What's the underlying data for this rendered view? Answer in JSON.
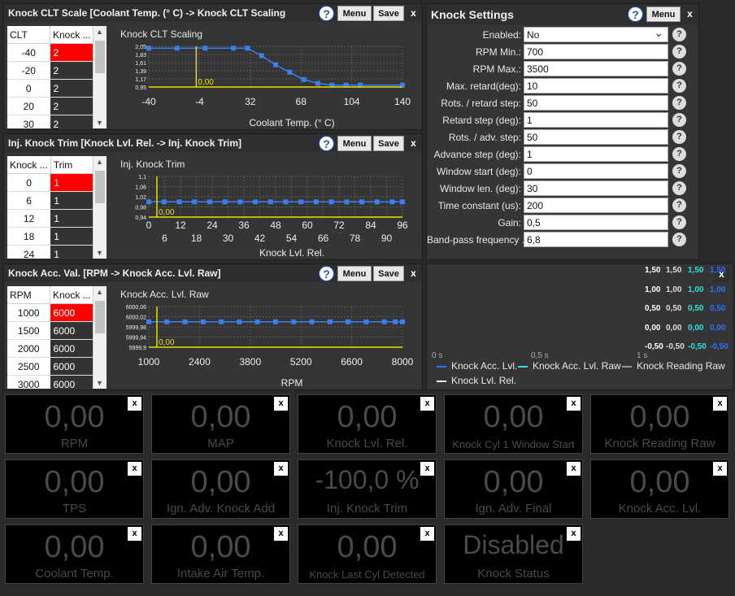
{
  "clt_panel": {
    "title": "Knock CLT Scale [Coolant Temp. (° C) -> Knock CLT Scaling",
    "menu": "Menu",
    "save": "Save",
    "close": "x",
    "help": "?",
    "col_key": "CLT",
    "col_val": "Knock ...",
    "rows": [
      [
        "-40",
        "2"
      ],
      [
        "-20",
        "2"
      ],
      [
        "0",
        "2"
      ],
      [
        "20",
        "2"
      ],
      [
        "30",
        "2"
      ]
    ],
    "chart_title": "Knock CLT Scaling"
  },
  "trim_panel": {
    "title": "Inj. Knock Trim [Knock Lvl. Rel. -> Inj. Knock Trim]",
    "menu": "Menu",
    "save": "Save",
    "close": "x",
    "help": "?",
    "col_key": "Knock ...",
    "col_val": "Trim",
    "rows": [
      [
        "0",
        "1"
      ],
      [
        "6",
        "1"
      ],
      [
        "12",
        "1"
      ],
      [
        "18",
        "1"
      ],
      [
        "24",
        "1"
      ]
    ],
    "chart_title": "Inj. Knock Trim"
  },
  "acc_panel": {
    "title": "Knock Acc. Val. [RPM -> Knock Acc. Lvl. Raw]",
    "menu": "Menu",
    "save": "Save",
    "close": "x",
    "help": "?",
    "col_key": "RPM",
    "col_val": "Knock ...",
    "rows": [
      [
        "1000",
        "6000"
      ],
      [
        "1500",
        "6000"
      ],
      [
        "2000",
        "6000"
      ],
      [
        "2500",
        "6000"
      ],
      [
        "3000",
        "6000"
      ]
    ],
    "chart_title": "Knock Acc. Lvl. Raw"
  },
  "settings": {
    "title": "Knock Settings",
    "menu": "Menu",
    "close": "x",
    "help": "?",
    "rows": [
      {
        "label": "Enabled:",
        "value": "No",
        "dropdown": true
      },
      {
        "label": "RPM Min.:",
        "value": "700"
      },
      {
        "label": "RPM Max.:",
        "value": "3500"
      },
      {
        "label": "Max. retard(deg):",
        "value": "10"
      },
      {
        "label": "Rots. / retard step:",
        "value": "50"
      },
      {
        "label": "Retard step (deg):",
        "value": "1"
      },
      {
        "label": "Rots. / adv. step:",
        "value": "50"
      },
      {
        "label": "Advance step (deg):",
        "value": "1"
      },
      {
        "label": "Window start (deg):",
        "value": "0"
      },
      {
        "label": "Window len. (deg):",
        "value": "30"
      },
      {
        "label": "Time constant (us):",
        "value": "200"
      },
      {
        "label": "Gain:",
        "value": "0,5"
      },
      {
        "label": "Band-pass frequency ...",
        "value": "6,8"
      }
    ]
  },
  "scope": {
    "close": "x",
    "time_labels": [
      "0 s",
      "0,5 s",
      "1 s"
    ],
    "legend": [
      "Knock Acc. Lvl.",
      "Knock Acc. Lvl. Raw",
      "Knock Reading Raw",
      "Knock Lvl. Rel."
    ],
    "axis_cols": [
      {
        "color": "#ffffff",
        "labels": [
          "1,50",
          "1,00",
          "0,50",
          "0,00",
          "-0,50"
        ]
      },
      {
        "color": "#dddddd",
        "labels": [
          "1,50",
          "1,00",
          "0,50",
          "0,00",
          "-0,50"
        ]
      },
      {
        "color": "#30e0e0",
        "labels": [
          "1,50",
          "1,00",
          "0,50",
          "0,00",
          "-0,50"
        ]
      },
      {
        "color": "#3070ff",
        "labels": [
          "1,50",
          "1,00",
          "0,50",
          "0,00",
          "-0,50"
        ]
      }
    ]
  },
  "gauges": [
    {
      "value": "0,00",
      "label": "RPM"
    },
    {
      "value": "0,00",
      "label": "MAP"
    },
    {
      "value": "0,00",
      "label": "Knock Lvl. Rel."
    },
    {
      "value": "0,00",
      "label": "Knock Cyl 1 Window Start"
    },
    {
      "value": "0,00",
      "label": "Knock Reading Raw"
    },
    {
      "value": "0,00",
      "label": "TPS"
    },
    {
      "value": "0,00",
      "label": "Ign. Adv. Knock Add"
    },
    {
      "value": "-100,0 %",
      "label": "Inj. Knock Trim"
    },
    {
      "value": "0,00",
      "label": "Ign. Adv. Final"
    },
    {
      "value": "0,00",
      "label": "Knock Acc. Lvl."
    },
    {
      "value": "0,00",
      "label": "Coolant Temp."
    },
    {
      "value": "0,00",
      "label": "Intake Air Temp."
    },
    {
      "value": "0,00",
      "label": "Knock Last Cyl Detected"
    },
    {
      "value": "Disabled",
      "label": "Knock Status"
    }
  ],
  "gauge_close": "x",
  "chart_data": [
    {
      "type": "line",
      "xlabel": "Coolant Temp. (° C)",
      "x_ticks": [
        "-40",
        "-4",
        "32",
        "68",
        "104",
        "140"
      ],
      "y_ticks": [
        "2,05",
        "1,83",
        "1,61",
        "1,39",
        "1,17",
        "0,95"
      ],
      "cursor_label": "0,00",
      "xlim": [
        -40,
        140
      ],
      "ylim": [
        0.95,
        2.05
      ],
      "x": [
        -40,
        -20,
        0,
        20,
        30,
        40,
        50,
        60,
        70,
        80,
        90,
        100,
        110,
        140
      ],
      "values": [
        2,
        2,
        2,
        2,
        2,
        1.8,
        1.55,
        1.35,
        1.15,
        1.05,
        1,
        1,
        1,
        1
      ]
    },
    {
      "type": "line",
      "xlabel": "Knock Lvl. Rel.",
      "x_ticks": [
        "0",
        "6",
        "12",
        "18",
        "24",
        "30",
        "36",
        "42",
        "48",
        "54",
        "60",
        "66",
        "72",
        "78",
        "84",
        "90",
        "96"
      ],
      "y_ticks": [
        "1,1",
        "1,06",
        "1,02",
        "0,98",
        "0,94"
      ],
      "cursor_label": "0,00",
      "xlim": [
        0,
        100
      ],
      "ylim": [
        0.94,
        1.1
      ],
      "x": [
        0,
        6,
        12,
        18,
        24,
        30,
        36,
        42,
        48,
        54,
        60,
        66,
        72,
        78,
        84,
        90,
        96,
        100
      ],
      "values": [
        1,
        1,
        1,
        1,
        1,
        1,
        1,
        1,
        1,
        1,
        1,
        1,
        1,
        1,
        1,
        1,
        1,
        1
      ]
    },
    {
      "type": "line",
      "xlabel": "RPM",
      "x_ticks": [
        "1000",
        "2400",
        "3800",
        "5200",
        "6600",
        "8000"
      ],
      "y_ticks": [
        "6000,06",
        "6000,02",
        "5999,98",
        "5999,94",
        "5999,9"
      ],
      "cursor_label": "0,00",
      "xlim": [
        1000,
        8000
      ],
      "ylim": [
        5999.9,
        6000.06
      ],
      "x": [
        1000,
        1500,
        2000,
        2500,
        3000,
        3500,
        4000,
        4500,
        5000,
        5500,
        6000,
        6500,
        7000,
        7500,
        7800,
        8000
      ],
      "values": [
        6000,
        6000,
        6000,
        6000,
        6000,
        6000,
        6000,
        6000,
        6000,
        6000,
        6000,
        6000,
        6000,
        6000,
        6000,
        6000
      ]
    }
  ]
}
